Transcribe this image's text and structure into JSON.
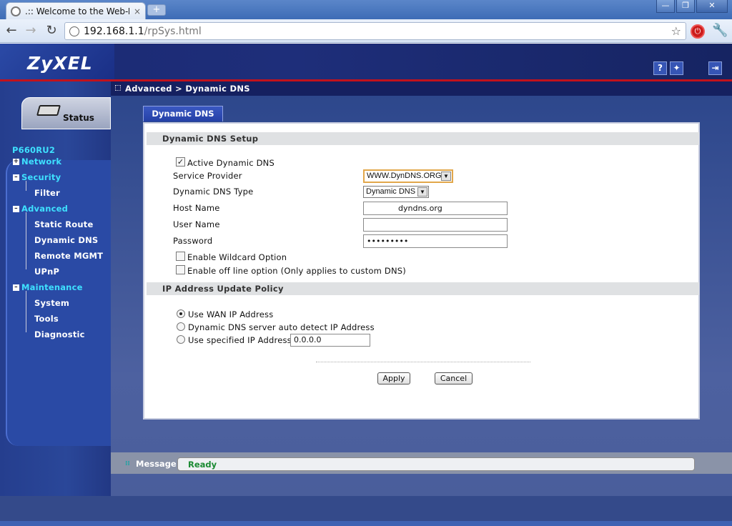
{
  "browser": {
    "tab_title": ".:: Welcome to the Web-Bas",
    "tab_close": "×",
    "new_tab": "+",
    "url_host": "192.168.1.1",
    "url_path": "/rpSys.html",
    "window_buttons": [
      "—",
      "❐",
      "✕"
    ]
  },
  "header": {
    "logo": "ZyXEL",
    "icons": [
      "help-icon",
      "wizard-icon",
      "logout-icon"
    ]
  },
  "breadcrumb": "Advanced > Dynamic DNS",
  "status_tab": "Status",
  "sidebar": {
    "model": "P660RU2",
    "items": [
      {
        "label": "Network",
        "level": "top",
        "toggle": "+"
      },
      {
        "label": "Security",
        "level": "top",
        "toggle": "-"
      },
      {
        "label": "Filter",
        "level": "sub"
      },
      {
        "label": "Advanced",
        "level": "top",
        "toggle": "-"
      },
      {
        "label": "Static Route",
        "level": "sub"
      },
      {
        "label": "Dynamic DNS",
        "level": "sub"
      },
      {
        "label": "Remote MGMT",
        "level": "sub"
      },
      {
        "label": "UPnP",
        "level": "sub"
      },
      {
        "label": "Maintenance",
        "level": "top",
        "toggle": "-"
      },
      {
        "label": "System",
        "level": "sub"
      },
      {
        "label": "Tools",
        "level": "sub"
      },
      {
        "label": "Diagnostic",
        "level": "sub"
      }
    ]
  },
  "content": {
    "tab": "Dynamic DNS",
    "setup_heading": "Dynamic DNS Setup",
    "active_label": "Active Dynamic DNS",
    "active_checked": true,
    "service_provider_label": "Service Provider",
    "service_provider_value": "WWW.DynDNS.ORG",
    "ddns_type_label": "Dynamic DNS Type",
    "ddns_type_value": "Dynamic DNS",
    "host_name_label": "Host Name",
    "host_name_value": "dyndns.org",
    "user_name_label": "User Name",
    "user_name_value": "",
    "password_label": "Password",
    "password_value": "•••••••••",
    "wildcard_label": "Enable Wildcard Option",
    "wildcard_checked": false,
    "offline_label": "Enable off line option (Only applies to custom DNS)",
    "offline_checked": false,
    "policy_heading": "IP Address Update Policy",
    "policy_options": [
      {
        "label": "Use WAN IP Address",
        "selected": true
      },
      {
        "label": "Dynamic DNS server auto detect IP Address",
        "selected": false
      },
      {
        "label": "Use specified IP Address",
        "selected": false
      }
    ],
    "specified_ip_value": "0.0.0.0",
    "apply_label": "Apply",
    "cancel_label": "Cancel"
  },
  "message": {
    "label": "Message",
    "text": "Ready"
  },
  "colors": {
    "accent_cyan": "#3ee1ff",
    "brand_red": "#c1121c",
    "ready_green": "#1a8a32"
  }
}
